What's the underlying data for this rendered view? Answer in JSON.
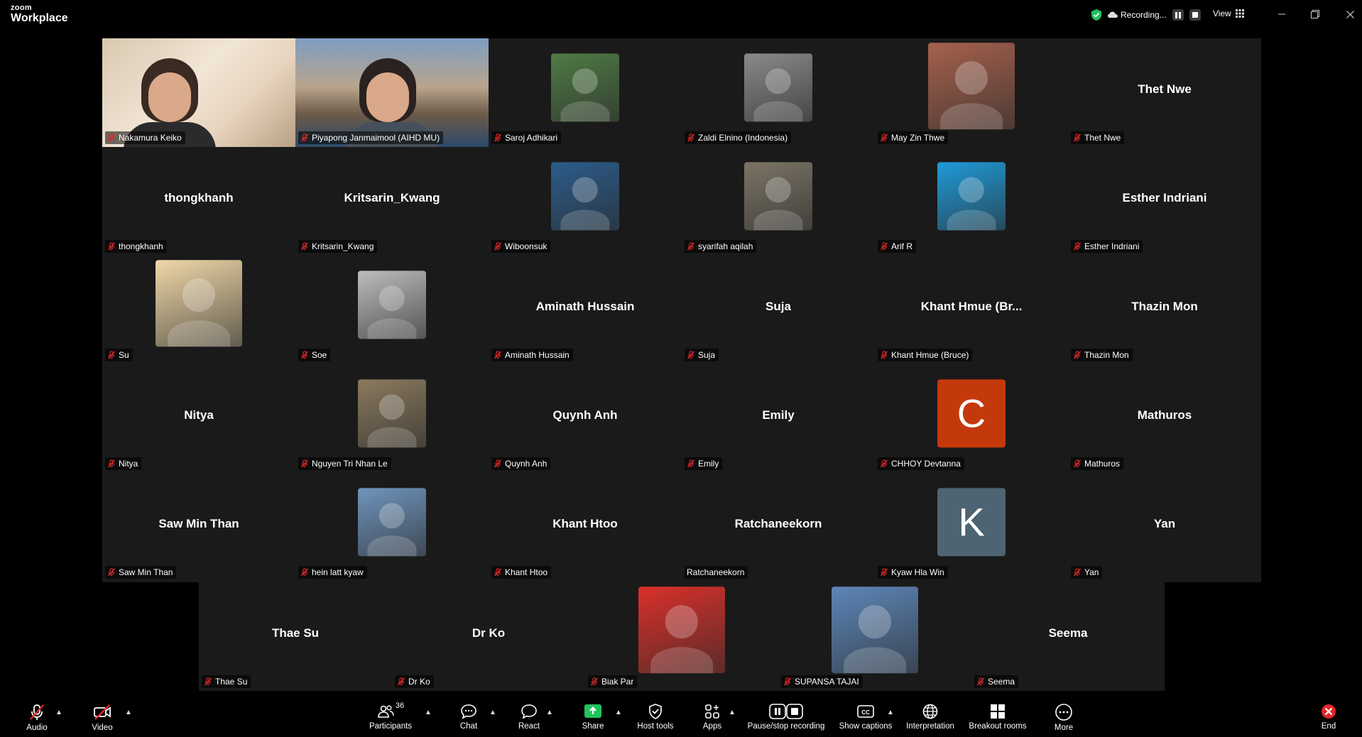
{
  "app": {
    "logo_small": "zoom",
    "logo_big": "Workplace",
    "recording_label": "Recording...",
    "view_label": "View"
  },
  "participants": [
    {
      "name": "Nakamura Keiko",
      "label": "Nakamura Keiko",
      "kind": "video",
      "active": true
    },
    {
      "name": "Piyapong Janmaimool (AIHD MU)",
      "label": "Piyapong Janmaimool (AIHD MU)",
      "kind": "video"
    },
    {
      "name": "Saroj Adhikari",
      "label": "Saroj Adhikari",
      "kind": "photo",
      "avatar_color": "#4f7a45"
    },
    {
      "name": "Zaldi Elnino (Indonesia)",
      "label": "Zaldi Elnino (Indonesia)",
      "kind": "photo",
      "avatar_color": "#8a8a8a"
    },
    {
      "name": "May Zin Thwe",
      "label": "May Zin Thwe",
      "kind": "photo",
      "avatar_color": "#a6614d"
    },
    {
      "name": "Thet Nwe",
      "label": "Thet Nwe",
      "kind": "name"
    },
    {
      "name": "thongkhanh",
      "label": "thongkhanh",
      "kind": "name"
    },
    {
      "name": "Kritsarin_Kwang",
      "label": "Kritsarin_Kwang",
      "kind": "name"
    },
    {
      "name": "Wiboonsuk",
      "label": "Wiboonsuk",
      "kind": "photo",
      "avatar_color": "#2b5c8a"
    },
    {
      "name": "syarifah aqilah",
      "label": "syarifah aqilah",
      "kind": "photo",
      "avatar_color": "#7c7566"
    },
    {
      "name": "Arif R",
      "label": "Arif R",
      "kind": "photo",
      "avatar_color": "#1f9ad8"
    },
    {
      "name": "Esther Indriani",
      "label": "Esther Indriani",
      "kind": "name"
    },
    {
      "name": "Su",
      "label": "Su",
      "kind": "photo",
      "avatar_color": "#f0d8a8"
    },
    {
      "name": "Soe",
      "label": "Soe",
      "kind": "photo",
      "avatar_color": "#bdbdbd"
    },
    {
      "name": "Aminath Hussain",
      "label": "Aminath Hussain",
      "kind": "name"
    },
    {
      "name": "Suja",
      "label": "Suja",
      "kind": "name"
    },
    {
      "name": "Khant Hmue (Br...",
      "label": "Khant Hmue (Bruce)",
      "kind": "name"
    },
    {
      "name": "Thazin Mon",
      "label": "Thazin Mon",
      "kind": "name"
    },
    {
      "name": "Nitya",
      "label": "Nitya",
      "kind": "name"
    },
    {
      "name": "Nguyen Tri Nhan Le",
      "label": "Nguyen Tri Nhan Le",
      "kind": "photo",
      "avatar_color": "#8b7a5e"
    },
    {
      "name": "Quynh Anh",
      "label": "Quynh Anh",
      "kind": "name"
    },
    {
      "name": "Emily",
      "label": "Emily",
      "kind": "name"
    },
    {
      "name": "CHHOY Devtanna",
      "label": "CHHOY Devtanna",
      "kind": "letter",
      "letter": "C",
      "avatar_color": "#c4390c"
    },
    {
      "name": "Mathuros",
      "label": "Mathuros",
      "kind": "name"
    },
    {
      "name": "Saw Min Than",
      "label": "Saw Min Than",
      "kind": "name"
    },
    {
      "name": "hein latt kyaw",
      "label": "hein latt kyaw",
      "kind": "photo",
      "avatar_color": "#6f95bd"
    },
    {
      "name": "Khant Htoo",
      "label": "Khant Htoo",
      "kind": "name"
    },
    {
      "name": "Ratchaneekorn",
      "label": "Ratchaneekorn",
      "kind": "name",
      "unmuted": true
    },
    {
      "name": "Kyaw Hla Win",
      "label": "Kyaw Hla Win",
      "kind": "letter",
      "letter": "K",
      "avatar_color": "#4d6472"
    },
    {
      "name": "Yan",
      "label": "Yan",
      "kind": "name"
    }
  ],
  "last_row": [
    {
      "name": "Thae Su",
      "label": "Thae Su",
      "kind": "name"
    },
    {
      "name": "Dr Ko",
      "label": "Dr Ko",
      "kind": "name"
    },
    {
      "name": "Biak Par",
      "label": "Biak Par",
      "kind": "photo",
      "avatar_color": "#d9302a"
    },
    {
      "name": "SUPANSA TAJAI",
      "label": "SUPANSA TAJAI",
      "kind": "photo",
      "avatar_color": "#5d86b8"
    },
    {
      "name": "Seema",
      "label": "Seema",
      "kind": "name"
    }
  ],
  "toolbar": {
    "audio": "Audio",
    "video": "Video",
    "participants": "Participants",
    "participants_count": "36",
    "chat": "Chat",
    "react": "React",
    "share": "Share",
    "host_tools": "Host tools",
    "apps": "Apps",
    "pause_recording": "Pause/stop recording",
    "captions": "Show captions",
    "interpretation": "Interpretation",
    "breakout": "Breakout rooms",
    "more": "More",
    "end": "End"
  },
  "colors": {
    "muted_red": "#e02828",
    "share_green": "#22c25d",
    "active_border": "#3ddc84",
    "end_red": "#e02828"
  }
}
